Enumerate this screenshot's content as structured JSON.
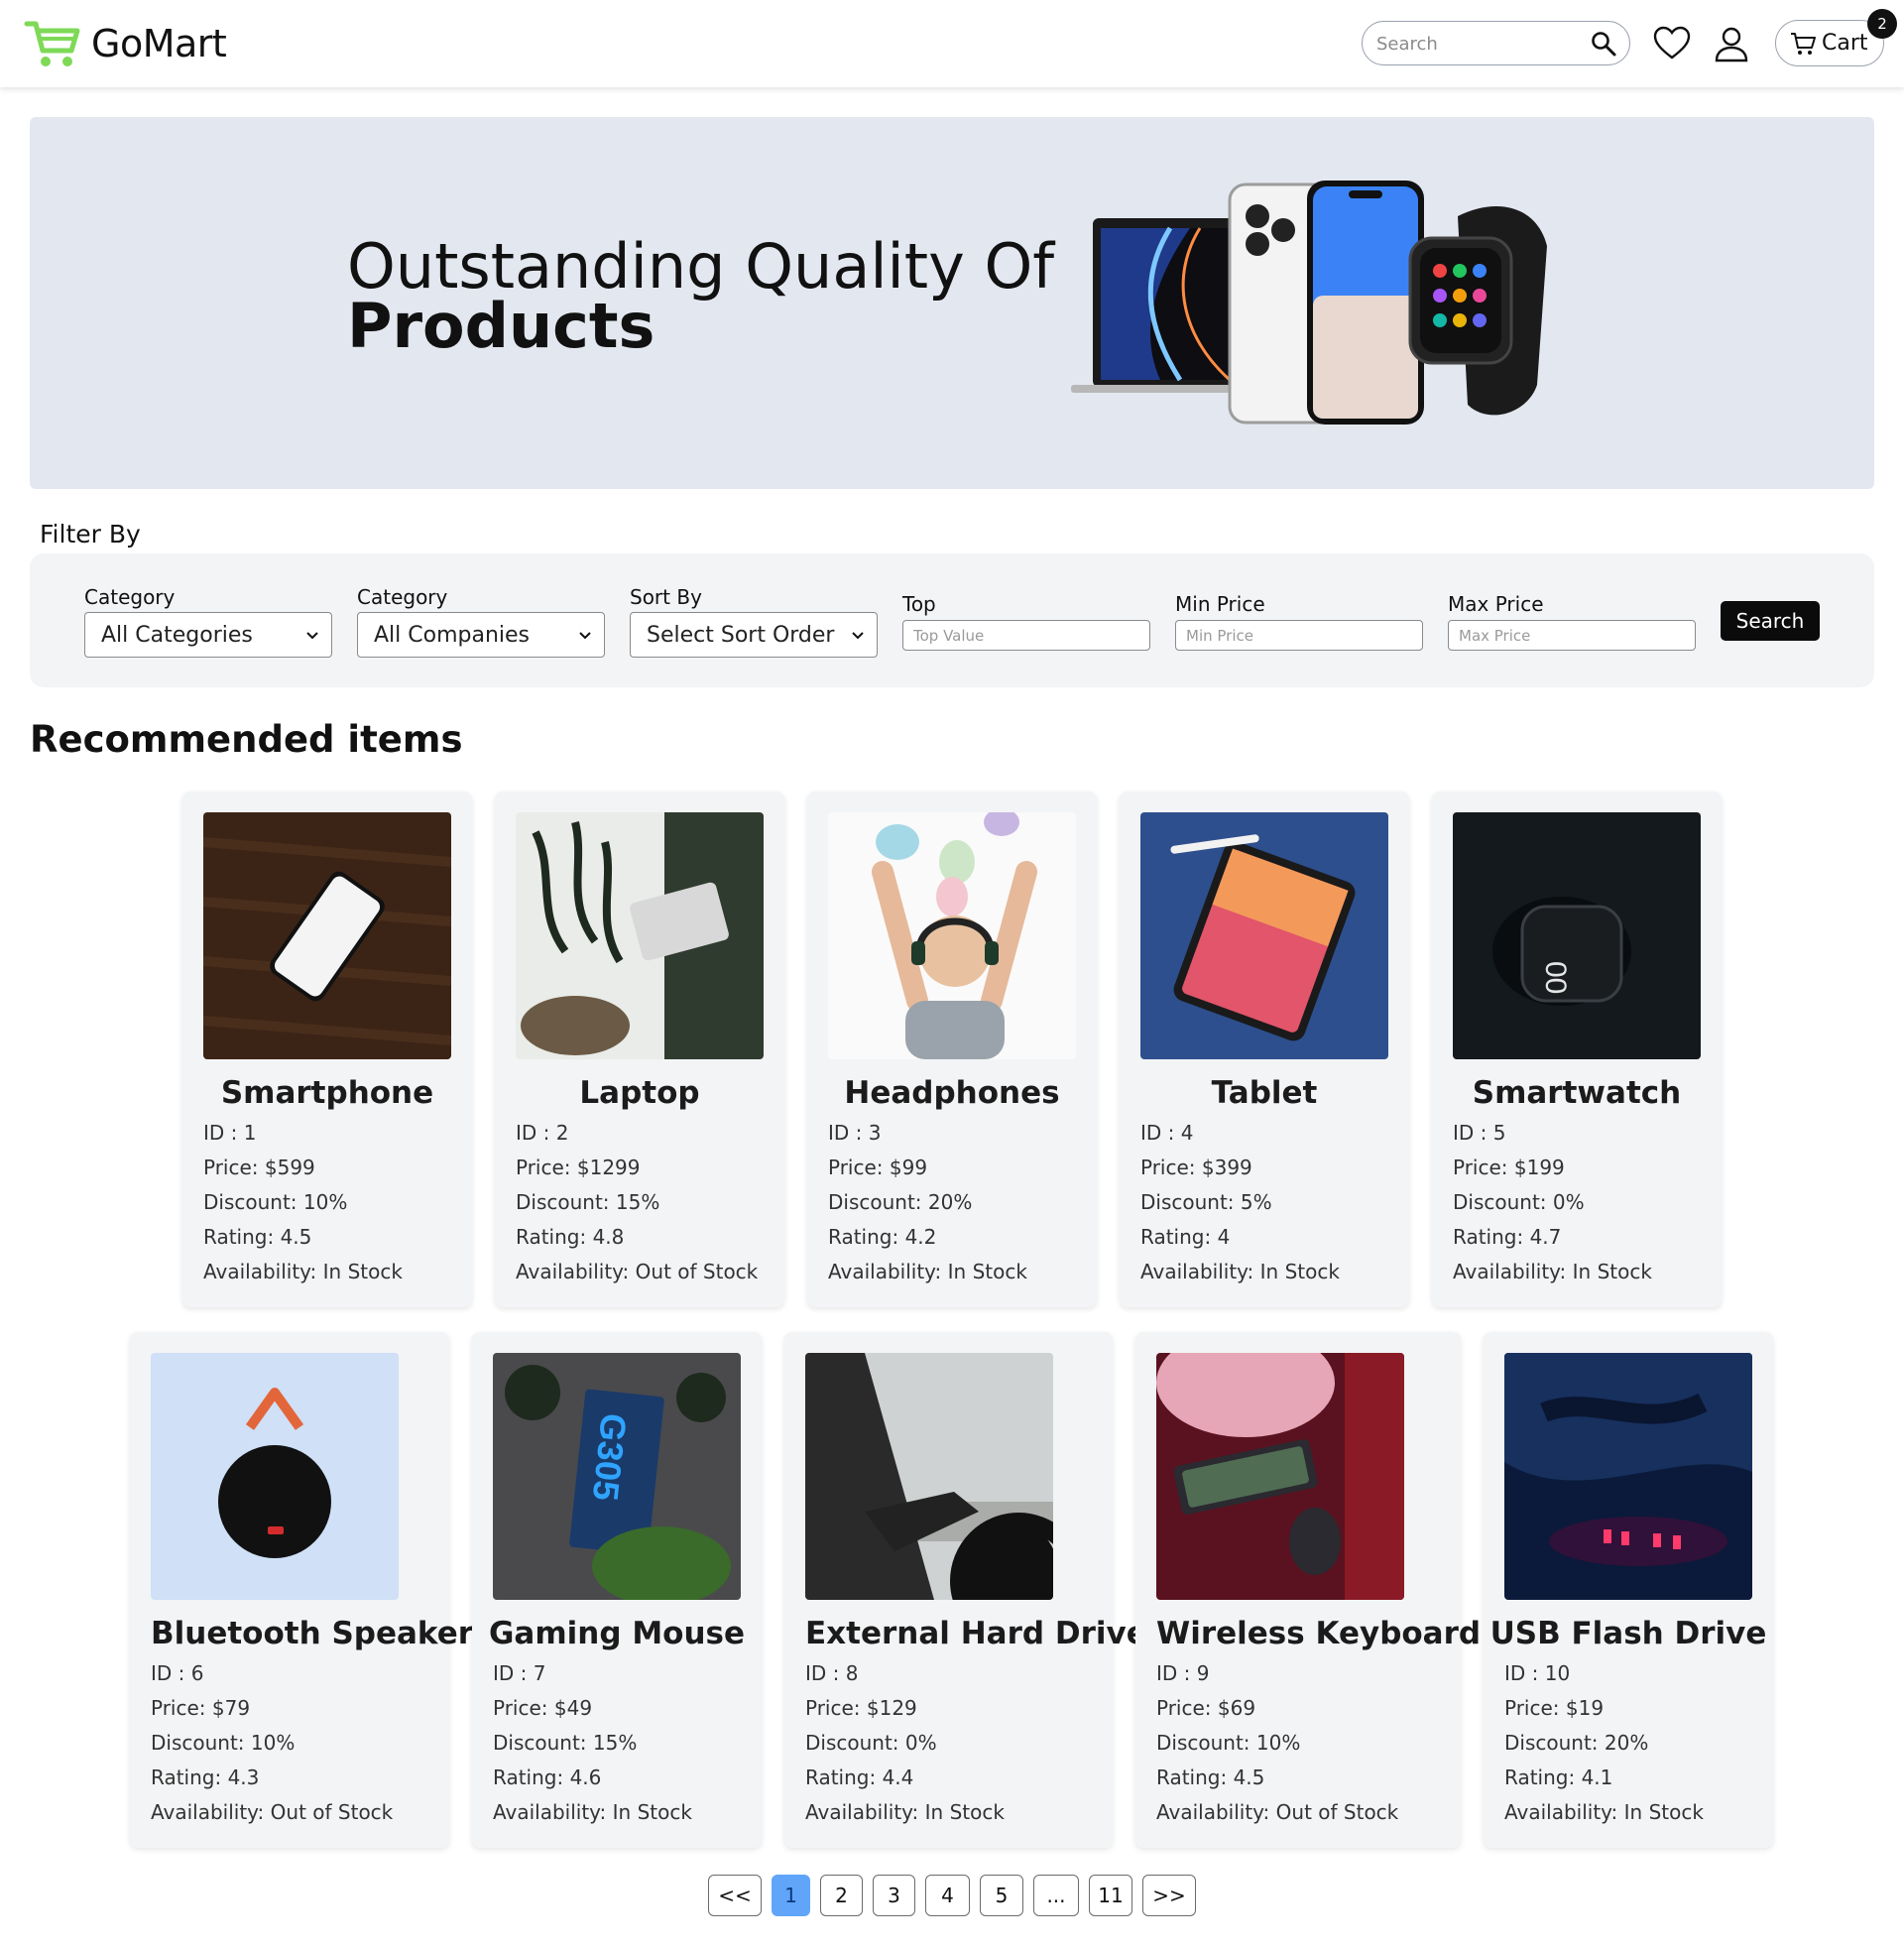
{
  "header": {
    "brand": "GoMart",
    "search_placeholder": "Search",
    "cart_label": "Cart",
    "cart_count": "2"
  },
  "banner": {
    "line1": "Outstanding Quality Of",
    "line2": "Products"
  },
  "filter": {
    "title": "Filter By",
    "category_label": "Category",
    "category_value": "All Categories",
    "company_label": "Category",
    "company_value": "All Companies",
    "sort_label": "Sort By",
    "sort_value": "Select Sort Order",
    "top_label": "Top",
    "top_placeholder": "Top Value",
    "min_label": "Min Price",
    "min_placeholder": "Min Price",
    "max_label": "Max Price",
    "max_placeholder": "Max Price",
    "search_button": "Search"
  },
  "recommended": {
    "title": "Recommended items",
    "items": [
      {
        "name": "Smartphone",
        "id": "ID : 1",
        "price": "Price: $599",
        "discount": "Discount: 10%",
        "rating": "Rating: 4.5",
        "availability": "Availability: In Stock"
      },
      {
        "name": "Laptop",
        "id": "ID : 2",
        "price": "Price: $1299",
        "discount": "Discount: 15%",
        "rating": "Rating: 4.8",
        "availability": "Availability: Out of Stock"
      },
      {
        "name": "Headphones",
        "id": "ID : 3",
        "price": "Price: $99",
        "discount": "Discount: 20%",
        "rating": "Rating: 4.2",
        "availability": "Availability: In Stock"
      },
      {
        "name": "Tablet",
        "id": "ID : 4",
        "price": "Price: $399",
        "discount": "Discount: 5%",
        "rating": "Rating: 4",
        "availability": "Availability: In Stock"
      },
      {
        "name": "Smartwatch",
        "id": "ID : 5",
        "price": "Price: $199",
        "discount": "Discount: 0%",
        "rating": "Rating: 4.7",
        "availability": "Availability: In Stock"
      },
      {
        "name": "Bluetooth Speaker",
        "id": "ID : 6",
        "price": "Price: $79",
        "discount": "Discount: 10%",
        "rating": "Rating: 4.3",
        "availability": "Availability: Out of Stock"
      },
      {
        "name": "Gaming Mouse",
        "id": "ID : 7",
        "price": "Price: $49",
        "discount": "Discount: 15%",
        "rating": "Rating: 4.6",
        "availability": "Availability: In Stock"
      },
      {
        "name": "External Hard Drive",
        "id": "ID : 8",
        "price": "Price: $129",
        "discount": "Discount: 0%",
        "rating": "Rating: 4.4",
        "availability": "Availability: In Stock"
      },
      {
        "name": "Wireless Keyboard",
        "id": "ID : 9",
        "price": "Price: $69",
        "discount": "Discount: 10%",
        "rating": "Rating: 4.5",
        "availability": "Availability: Out of Stock"
      },
      {
        "name": "USB Flash Drive",
        "id": "ID : 10",
        "price": "Price: $19",
        "discount": "Discount: 20%",
        "rating": "Rating: 4.1",
        "availability": "Availability: In Stock"
      }
    ]
  },
  "pagination": {
    "prev": "<<",
    "pages": [
      "1",
      "2",
      "3",
      "4",
      "5",
      "...",
      "11"
    ],
    "next": ">>",
    "current": "1"
  },
  "colors": {
    "brand_green": "#7ed957",
    "active_page": "#60a5fa",
    "banner_bg": "#e3e8f0",
    "panel_bg": "#f3f4f6"
  }
}
